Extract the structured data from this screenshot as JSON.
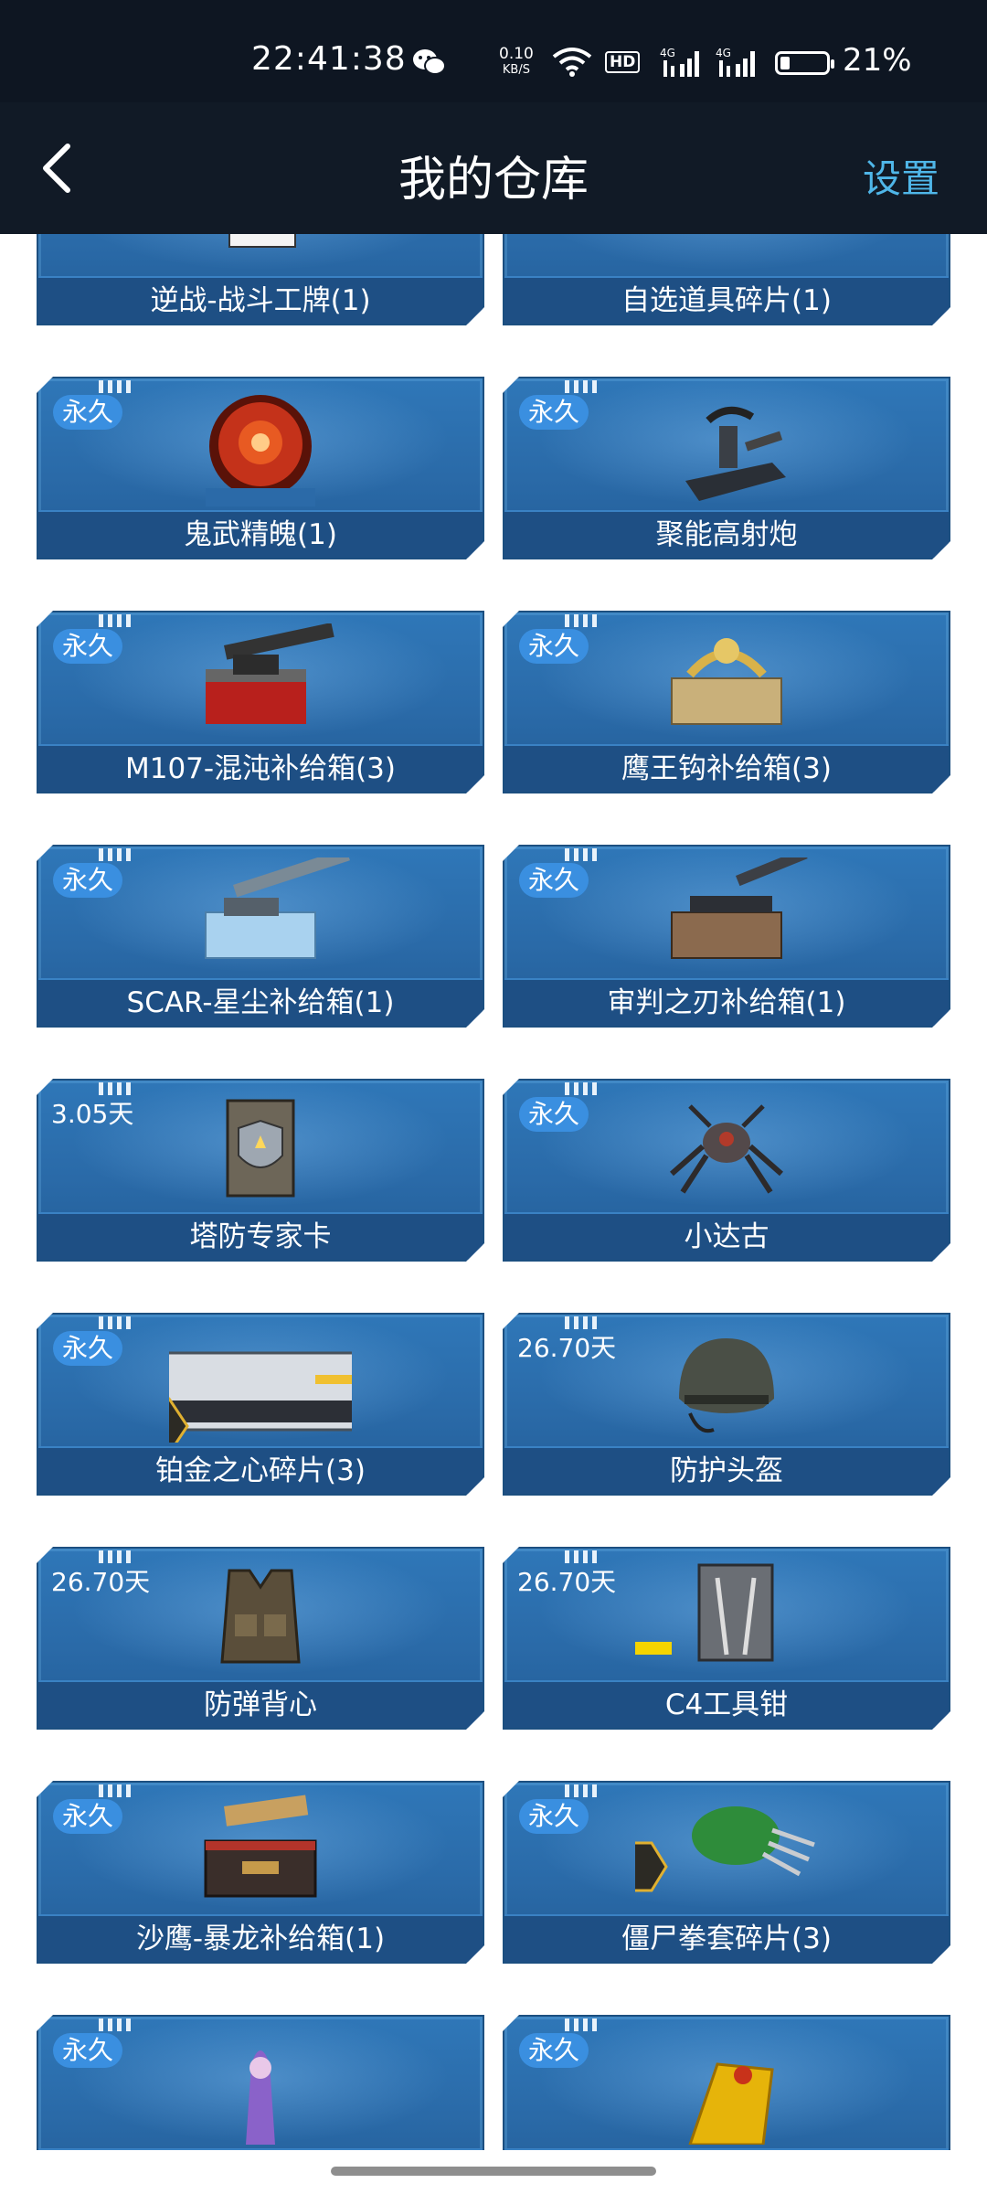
{
  "status_bar": {
    "time": "22:41:38",
    "net_speed_value": "0.10",
    "net_speed_unit": "KB/S",
    "hd_label": "HD",
    "signal1_label": "4G",
    "signal2_label": "4G",
    "battery_percent": "21%",
    "battery_level": 0.21
  },
  "nav": {
    "back_icon": "chevron-left-icon",
    "title": "我的仓库",
    "settings_label": "设置",
    "accent_color": "#4fb6e8"
  },
  "items": [
    {
      "name": "逆战-战斗工牌(1)",
      "badge": "",
      "icon": "badge-card-icon"
    },
    {
      "name": "自选道具碎片(1)",
      "badge": "",
      "icon": "crystal-shard-icon"
    },
    {
      "name": "鬼武精魄(1)",
      "badge": "永久",
      "icon": "red-orb-icon"
    },
    {
      "name": "聚能高射炮",
      "badge": "永久",
      "icon": "turret-icon"
    },
    {
      "name": "M107-混沌补给箱(3)",
      "badge": "永久",
      "icon": "supply-box-red-icon"
    },
    {
      "name": "鹰王钩补给箱(3)",
      "badge": "永久",
      "icon": "supply-box-gold-icon"
    },
    {
      "name": "SCAR-星尘补给箱(1)",
      "badge": "永久",
      "icon": "supply-box-blue-icon"
    },
    {
      "name": "审判之刃补给箱(1)",
      "badge": "永久",
      "icon": "supply-box-bronze-icon"
    },
    {
      "name": "塔防专家卡",
      "badge": "3.05天",
      "icon": "shield-card-icon"
    },
    {
      "name": "小达古",
      "badge": "永久",
      "icon": "spider-robot-icon"
    },
    {
      "name": "铂金之心碎片(3)",
      "badge": "永久",
      "icon": "platinum-weapon-fragment-icon"
    },
    {
      "name": "防护头盔",
      "badge": "26.70天",
      "icon": "helmet-icon"
    },
    {
      "name": "防弹背心",
      "badge": "26.70天",
      "icon": "vest-icon"
    },
    {
      "name": "C4工具钳",
      "badge": "26.70天",
      "icon": "pliers-icon"
    },
    {
      "name": "沙鹰-暴龙补给箱(1)",
      "badge": "永久",
      "icon": "supply-box-dark-icon"
    },
    {
      "name": "僵尸拳套碎片(3)",
      "badge": "永久",
      "icon": "zombie-claw-fragment-icon"
    },
    {
      "name": "",
      "badge": "永久",
      "icon": "character-icon"
    },
    {
      "name": "",
      "badge": "永久",
      "icon": "gold-item-icon"
    }
  ]
}
